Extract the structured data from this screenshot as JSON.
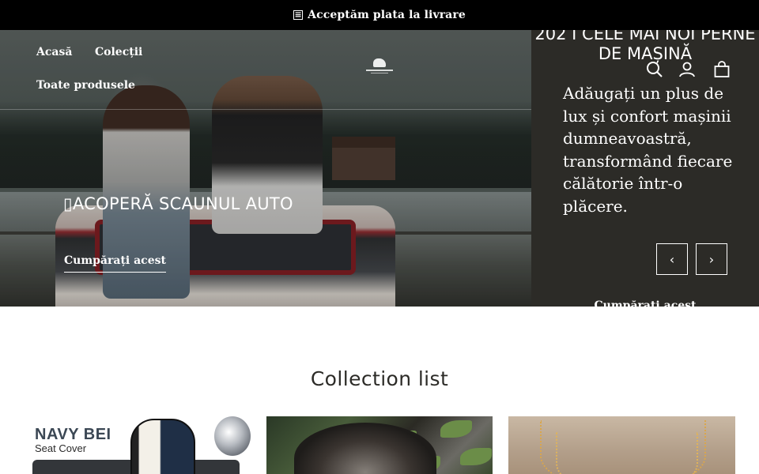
{
  "announcement": {
    "icon": "cash-icon",
    "text": "Acceptăm plata la livrare"
  },
  "nav": {
    "links": [
      {
        "label": "Acasă"
      },
      {
        "label": "Colecții"
      },
      {
        "label": "Toate produsele"
      }
    ],
    "logo": "brand-logo",
    "icons": [
      "search-icon",
      "account-icon",
      "cart-icon"
    ]
  },
  "hero": {
    "title": "ACOPERĂ SCAUNUL AUTO",
    "title_prefix_glyph": "▯",
    "cta": "Cumpărați acest"
  },
  "side_slide": {
    "title": "202 I CELE MAI NOI PERNE DE MAȘINĂ",
    "text": "Adăugați un plus de lux și confort mașinii dumneavoastră, transformând fiecare călătorie într-o plăcere.",
    "prev": "‹",
    "next": "›",
    "cta": "Cumpărați acest"
  },
  "collection": {
    "title": "Collection list",
    "cards": [
      {
        "brand": "NAVY BEI",
        "sub": "Seat Cover"
      },
      {},
      {}
    ]
  },
  "colors": {
    "announce_bg": "#000000",
    "side_bg": "#2c2b27",
    "text_dark": "#2c2b27"
  }
}
